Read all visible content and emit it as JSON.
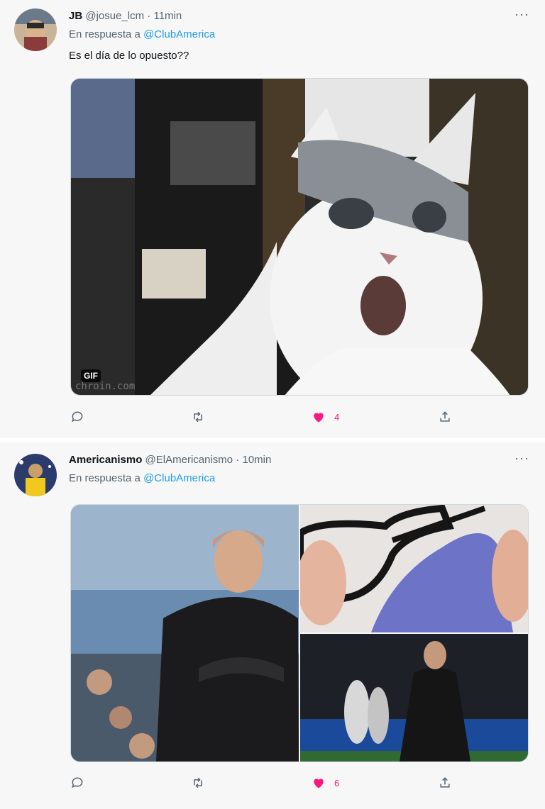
{
  "tweets": [
    {
      "name": "JB",
      "handle": "@josue_lcm",
      "separator": "·",
      "time": "11min",
      "reply_prefix": "En respuesta a",
      "reply_to": "@ClubAmerica",
      "text": "Es el día de lo opuesto??",
      "media": {
        "type": "gif",
        "badge": "GIF",
        "watermark": "chroin.com"
      },
      "actions": {
        "likes": "4"
      }
    },
    {
      "name": "Americanismo",
      "handle": "@ElAmericanismo",
      "separator": "·",
      "time": "10min",
      "reply_prefix": "En respuesta a",
      "reply_to": "@ClubAmerica",
      "media": {
        "type": "images",
        "count": 3
      },
      "actions": {
        "likes": "6"
      }
    }
  ],
  "more_glyph": "···",
  "colors": {
    "accent": "#1d9bf0",
    "like": "#f91880",
    "muted": "#536471",
    "background": "#f7f7f7"
  },
  "icons": [
    "reply-icon",
    "retweet-icon",
    "heart-icon",
    "share-icon",
    "more-icon"
  ]
}
